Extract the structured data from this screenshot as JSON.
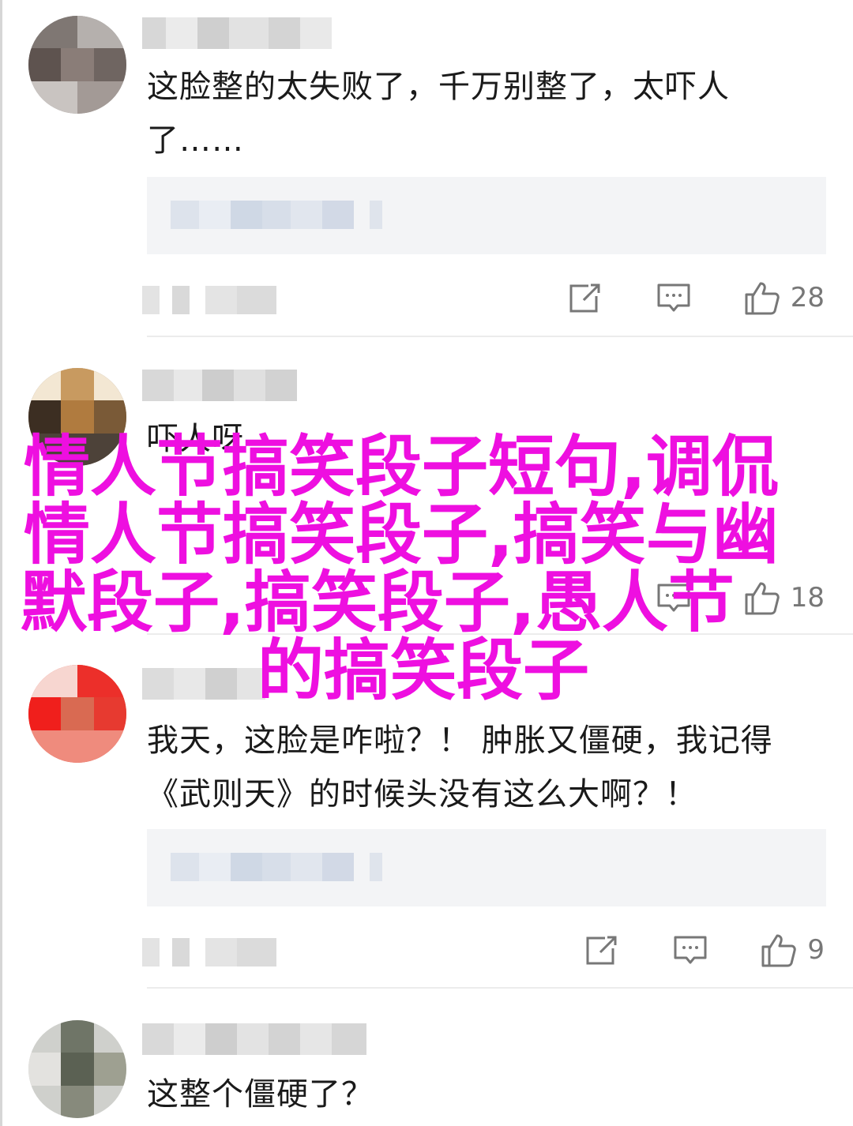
{
  "comments": [
    {
      "text_line1": "这脸整的太失败了，千万别整了，太吓人",
      "text_line2": "了……",
      "like_count": "28",
      "avatar_icon": "blurred-avatar-icon"
    },
    {
      "text_line1": "吓人呀",
      "like_count": "18",
      "avatar_icon": "blurred-avatar-icon"
    },
    {
      "text_line1": "我天，这脸是咋啦？！ 肿胀又僵硬，我记得",
      "text_line2": "《武则天》的时候头没有这么大啊？！",
      "like_count": "9",
      "avatar_icon": "blurred-avatar-icon"
    },
    {
      "text_line1": "这整个僵硬了？",
      "avatar_icon": "blurred-avatar-icon"
    }
  ],
  "icons": {
    "share": "share-icon",
    "reply": "comment-icon",
    "like": "thumbs-up-icon"
  },
  "overlay": {
    "line1": "情人节搞笑段子短句,调侃",
    "line2": "情人节搞笑段子,搞笑与幽",
    "line3": "默段子,搞笑段子,愚人节",
    "line4": "的搞笑段子",
    "color": "#ee0fe0"
  }
}
